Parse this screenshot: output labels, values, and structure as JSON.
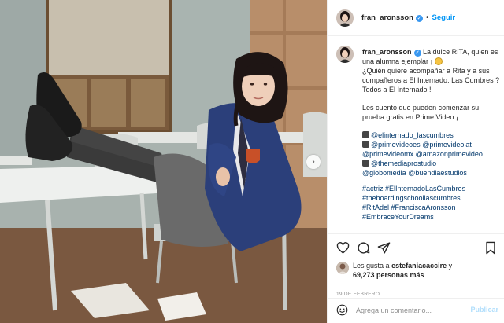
{
  "header": {
    "username": "fran_aronsson",
    "separator": "•",
    "follow_label": "Seguir"
  },
  "caption": {
    "username": "fran_aronsson",
    "intro": "La dulce RITA, quien es una alumna ejemplar ¡",
    "question": "¿Quién quiere acompañar a Rita y a sus compañeros a El Internado: Las Cumbres ? Todos a El Internado !",
    "prime": "Les cuento que pueden comenzar su prueba gratis en Prime Video ¡",
    "credit_1": "@elinternado_lascumbres",
    "credit_2a": "@primevideoes",
    "credit_2b": "@primevideolat",
    "credit_3a": "@primevideomx",
    "credit_3b": "@amazonprimevideo",
    "credit_4": "@themediaprostudio",
    "credit_5a": "@globomedia",
    "credit_5b": "@buendiaestudios",
    "hashtags": [
      "#actriz #ElInternadoLasCumbres",
      "#theboardingschoollascumbres",
      "#RitAdel #FranciscaAronsson",
      "#EmbraceYourDreams"
    ]
  },
  "likes": {
    "prefix": "Les gusta a",
    "liker": "estefaniacaccire",
    "conj": "y",
    "count": "69,273 personas más"
  },
  "date": "19 DE FEBRERO",
  "comment_box": {
    "placeholder": "Agrega un comentario...",
    "publish_label": "Publicar"
  },
  "icons": {
    "verified": "verified-badge-icon",
    "like": "heart-icon",
    "comment": "comment-icon",
    "share": "paper-plane-icon",
    "save": "bookmark-icon",
    "emoji": "smiley-icon",
    "next": "chevron-right-icon"
  },
  "colors": {
    "accent": "#0095f6",
    "verified": "#3897f0",
    "link": "#00376b",
    "muted": "#8e8e8e"
  }
}
